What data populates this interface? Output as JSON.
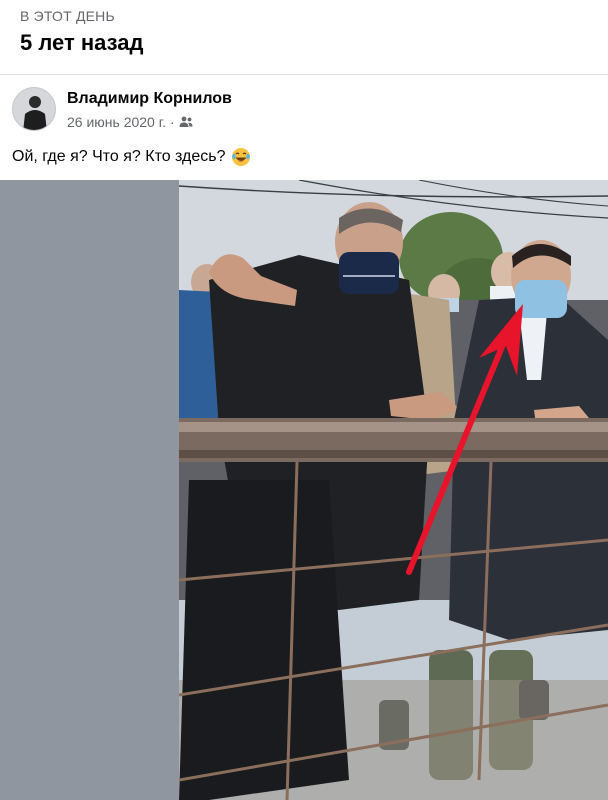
{
  "memory": {
    "kicker": "В ЭТОТ ДЕНЬ",
    "title": "5 лет назад"
  },
  "post": {
    "author": "Владимир Корнилов",
    "date": "26 июнь 2020 г.",
    "separator": "·",
    "audience_icon": "friends-icon",
    "text": "Ой, где я? Что я? Кто здесь?",
    "emoji": "laughing-tears-emoji"
  },
  "photo": {
    "description_icon": "photo"
  },
  "colors": {
    "secondary_text": "#65676b",
    "divider": "#d9dadd",
    "left_panel": "#8f96a0",
    "arrow": "#e8142b"
  }
}
